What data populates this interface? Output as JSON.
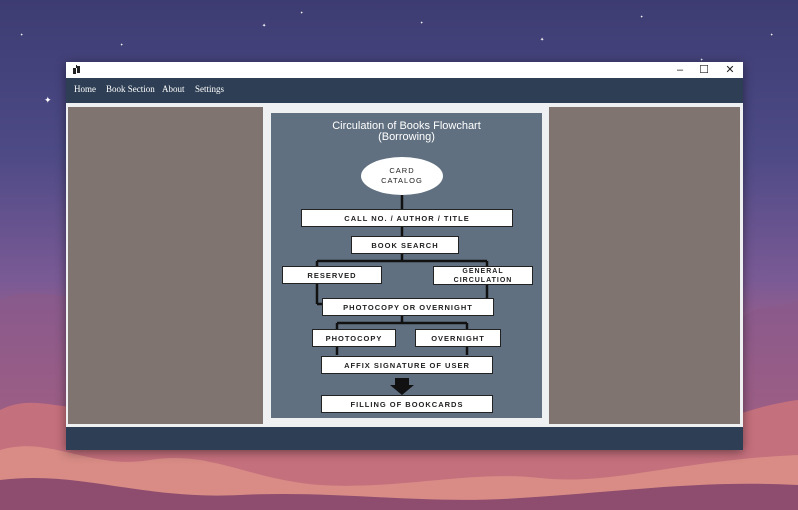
{
  "window": {
    "controls": {
      "minimize": "–",
      "maximize": "☐",
      "close": "✕"
    }
  },
  "nav": {
    "items": [
      "Home",
      "Book Section",
      "About",
      "Settings"
    ]
  },
  "flowchart": {
    "title_line1": "Circulation of Books Flowchart",
    "title_line2": "(Borrowing)",
    "start": {
      "line1": "CARD",
      "line2": "CATALOG"
    },
    "steps": {
      "call_no": "CALL NO. / AUTHOR / TITLE",
      "book_search": "BOOK SEARCH",
      "reserved": "RESERVED",
      "general_circulation": "GENERAL CIRCULATION",
      "photocopy_or_overnight": "PHOTOCOPY OR OVERNIGHT",
      "photocopy": "PHOTOCOPY",
      "overnight": "OVERNIGHT",
      "affix_signature": "AFFIX SIGNATURE OF USER",
      "filling": "FILLING OF BOOKCARDS"
    }
  },
  "colors": {
    "navbar": "#2e3f55",
    "panel": "#607080",
    "side_panels": "#7f7470",
    "content_bg": "#eef0f2"
  },
  "icons": [
    "app-icon",
    "minimize-icon",
    "maximize-icon",
    "close-icon",
    "arrow-down-icon"
  ]
}
